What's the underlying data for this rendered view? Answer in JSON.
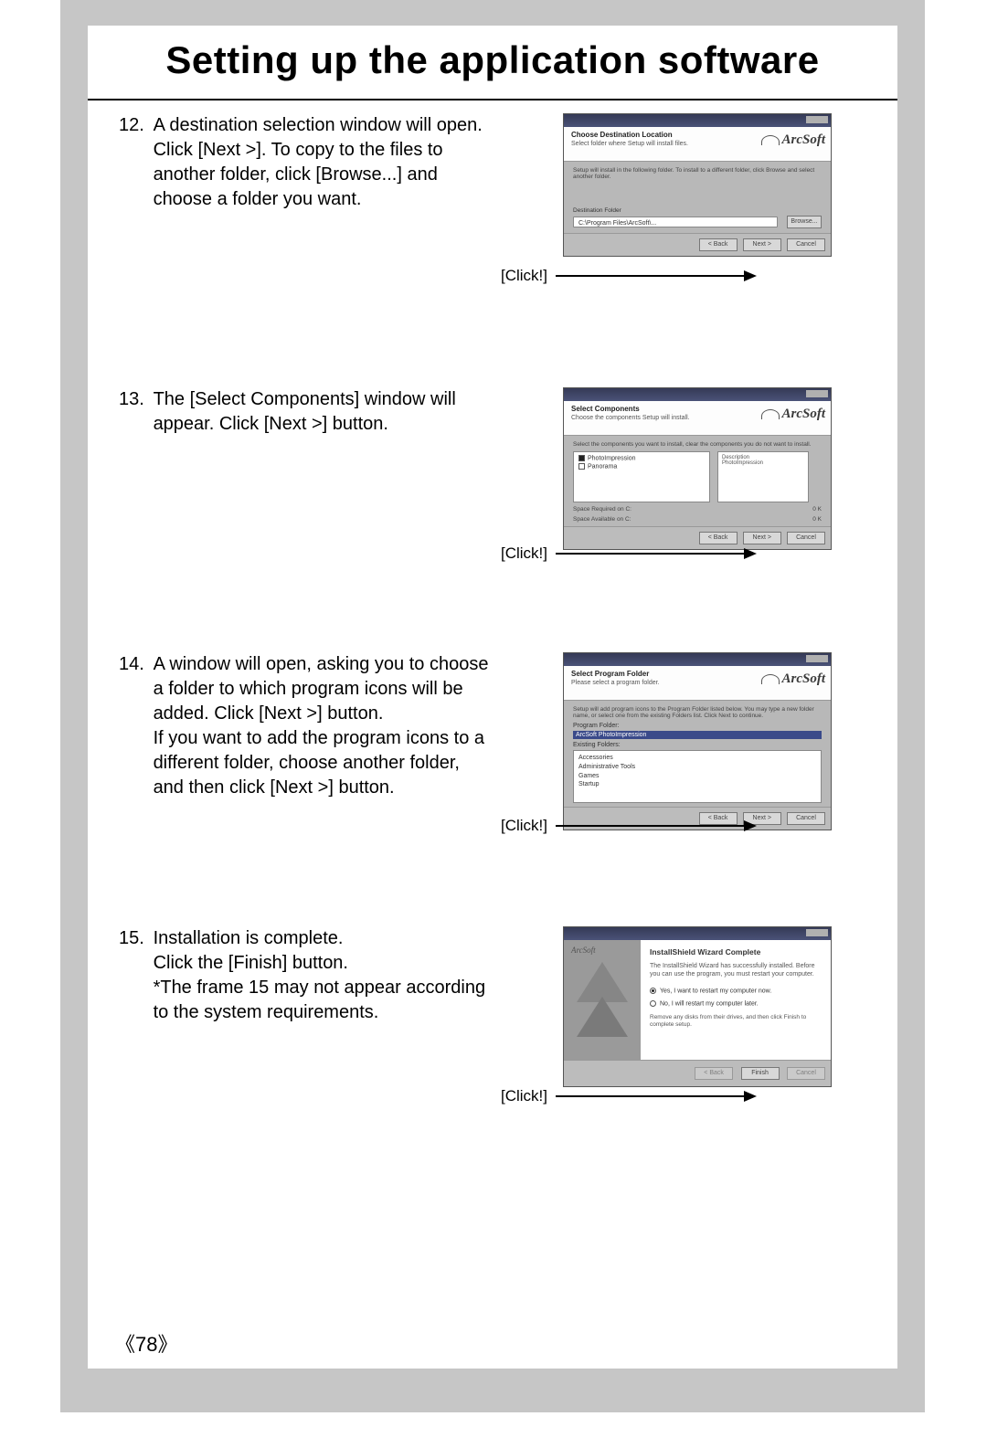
{
  "page_title": "Setting up the application software",
  "page_number": "78",
  "click_label": "[Click!]",
  "brand": "ArcSoft",
  "steps": [
    {
      "num": "12.",
      "lines": [
        "A destination selection window will open.",
        "Click [Next >]. To copy to the files to",
        "another folder, click [Browse...] and",
        "choose a folder you want."
      ],
      "dialog_title": "Choose Destination Location",
      "dialog_sub": "Select folder where Setup will install files."
    },
    {
      "num": "13.",
      "lines": [
        "The [Select Components] window will",
        "appear. Click [Next >] button."
      ],
      "dialog_title": "Select Components",
      "dialog_sub": "Choose the components Setup will install."
    },
    {
      "num": "14.",
      "lines": [
        "A window will open, asking you to choose",
        "a folder to which program icons will be",
        "added. Click [Next >] button.",
        "If you want to add the program icons to a",
        "different folder, choose another folder,",
        "and then click [Next >] button."
      ],
      "dialog_title": "Select Program Folder",
      "dialog_sub": "Please select a program folder."
    },
    {
      "num": "15.",
      "lines": [
        "Installation is complete.",
        "Click the [Finish] button.",
        "*The frame 15 may not appear according",
        " to the system requirements."
      ],
      "dialog_title": "InstallShield Wizard Complete"
    }
  ],
  "buttons": {
    "back": "< Back",
    "next": "Next >",
    "cancel": "Cancel",
    "browse": "Browse...",
    "finish": "Finish"
  }
}
